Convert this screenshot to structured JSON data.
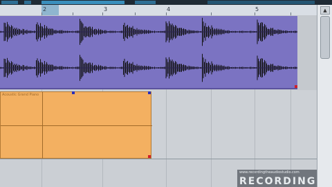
{
  "ruler": {
    "bars": [
      "2",
      "3",
      "4",
      "5"
    ]
  },
  "midi_part": {
    "name": "Acoustic Grand Piano"
  },
  "watermark": {
    "url": "www.recordingtheaudiostudio.com",
    "title": "RECORDING"
  },
  "colors": {
    "audio": "#7b73c2",
    "midi": "#f3b061",
    "waveform": "#111111"
  }
}
